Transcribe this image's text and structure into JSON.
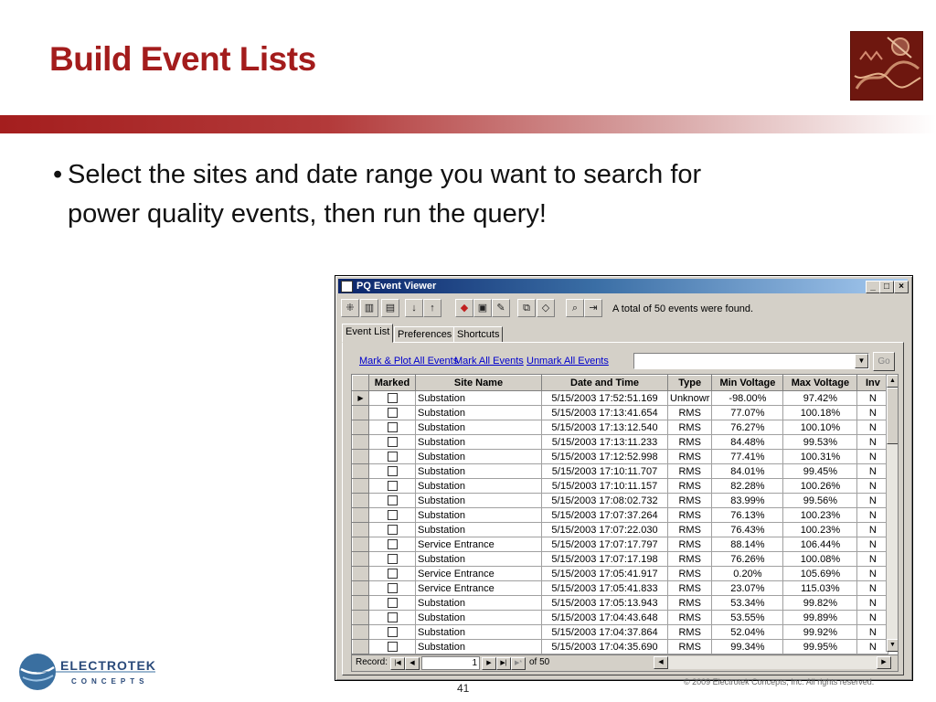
{
  "slide": {
    "title": "Build Event Lists",
    "bullet_symbol": "•",
    "bullet_line1": "Select the sites and date range you want to search for",
    "bullet_line2": "power quality events, then run the query!",
    "page_number": "41",
    "copyright": "© 2009 Electrotek Concepts,  Inc. All rights reserved.",
    "logo_word_main": "ELECTROTEK",
    "logo_word_sub": "CONCEPTS",
    "title_color": "#a31c1c"
  },
  "window": {
    "title": "PQ Event Viewer",
    "minimize": "_",
    "maximize": "□",
    "close": "×",
    "toolbar_message": "A total of 50 events were found.",
    "tabs": [
      "Event List",
      "Preferences",
      "Shortcuts"
    ],
    "links": [
      "Mark & Plot All Events",
      "Mark All Events",
      "Unmark All Events"
    ],
    "combo_value": "",
    "go_label": "Go",
    "columns": [
      "Marked",
      "Site Name",
      "Date and Time",
      "Type",
      "Min Voltage",
      "Max Voltage",
      "Inv"
    ],
    "rows": [
      [
        "Substation",
        "5/15/2003 17:52:51.169",
        "Unknowr",
        "-98.00%",
        "97.42%",
        "N"
      ],
      [
        "Substation",
        "5/15/2003 17:13:41.654",
        "RMS",
        "77.07%",
        "100.18%",
        "N"
      ],
      [
        "Substation",
        "5/15/2003 17:13:12.540",
        "RMS",
        "76.27%",
        "100.10%",
        "N"
      ],
      [
        "Substation",
        "5/15/2003 17:13:11.233",
        "RMS",
        "84.48%",
        "99.53%",
        "N"
      ],
      [
        "Substation",
        "5/15/2003 17:12:52.998",
        "RMS",
        "77.41%",
        "100.31%",
        "N"
      ],
      [
        "Substation",
        "5/15/2003 17:10:11.707",
        "RMS",
        "84.01%",
        "99.45%",
        "N"
      ],
      [
        "Substation",
        "5/15/2003 17:10:11.157",
        "RMS",
        "82.28%",
        "100.26%",
        "N"
      ],
      [
        "Substation",
        "5/15/2003 17:08:02.732",
        "RMS",
        "83.99%",
        "99.56%",
        "N"
      ],
      [
        "Substation",
        "5/15/2003 17:07:37.264",
        "RMS",
        "76.13%",
        "100.23%",
        "N"
      ],
      [
        "Substation",
        "5/15/2003 17:07:22.030",
        "RMS",
        "76.43%",
        "100.23%",
        "N"
      ],
      [
        "Service Entrance",
        "5/15/2003 17:07:17.797",
        "RMS",
        "88.14%",
        "106.44%",
        "N"
      ],
      [
        "Substation",
        "5/15/2003 17:07:17.198",
        "RMS",
        "76.26%",
        "100.08%",
        "N"
      ],
      [
        "Service Entrance",
        "5/15/2003 17:05:41.917",
        "RMS",
        "0.20%",
        "105.69%",
        "N"
      ],
      [
        "Service Entrance",
        "5/15/2003 17:05:41.833",
        "RMS",
        "23.07%",
        "115.03%",
        "N"
      ],
      [
        "Substation",
        "5/15/2003 17:05:13.943",
        "RMS",
        "53.34%",
        "99.82%",
        "N"
      ],
      [
        "Substation",
        "5/15/2003 17:04:43.648",
        "RMS",
        "53.55%",
        "99.89%",
        "N"
      ],
      [
        "Substation",
        "5/15/2003 17:04:37.864",
        "RMS",
        "52.04%",
        "99.92%",
        "N"
      ],
      [
        "Substation",
        "5/15/2003 17:04:35.690",
        "RMS",
        "99.34%",
        "99.95%",
        "N"
      ]
    ],
    "record_label": "Record:",
    "record_current": "1",
    "record_total": "of  50"
  }
}
